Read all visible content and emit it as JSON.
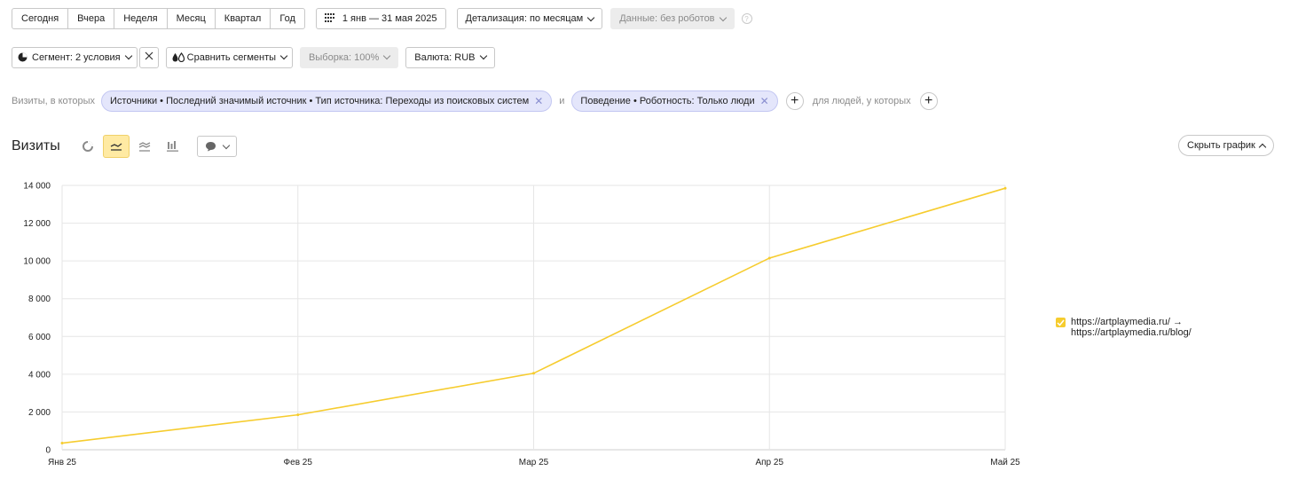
{
  "periods": [
    "Сегодня",
    "Вчера",
    "Неделя",
    "Месяц",
    "Квартал",
    "Год"
  ],
  "date_range": "1 янв — 31 мая 2025",
  "detail": "Детализация: по месяцам",
  "data_filter": "Данные: без роботов",
  "help": "?",
  "segment": "Сегмент: 2 условия",
  "compare": "Сравнить сегменты",
  "sample": "Выборка: 100%",
  "currency": "Валюта: RUB",
  "filters": {
    "visits_prefix": "Визиты, в которых",
    "chip1": "Источники • Последний значимый источник • Тип источника: Переходы из поисковых систем",
    "and": "и",
    "chip2": "Поведение • Роботность: Только люди",
    "people_label": "для людей, у которых"
  },
  "chart_header": {
    "title": "Визиты",
    "hide_chart": "Скрыть график"
  },
  "colors": {
    "line": "#f6cc2e",
    "grid": "#e6e6e6",
    "chip_bg": "#e4e6fb",
    "active_toggle": "#ffeaa3"
  },
  "icons": [
    "pie-chart-icon",
    "line-chart-icon",
    "area-chart-icon",
    "bar-chart-icon",
    "comment-icon",
    "calendar-icon",
    "close-icon"
  ],
  "chart_data": {
    "type": "line",
    "categories": [
      "Янв 25",
      "Фев 25",
      "Мар 25",
      "Апр 25",
      "Май 25"
    ],
    "series": [
      {
        "name": "https://artplaymedia.ru/ → https://artplaymedia.ru/blog/",
        "values": [
          350,
          1850,
          4050,
          10150,
          13850
        ]
      }
    ],
    "ylim": [
      0,
      14000
    ],
    "yticks": [
      0,
      2000,
      4000,
      6000,
      8000,
      10000,
      12000,
      14000
    ],
    "ytick_labels": [
      "0",
      "2 000",
      "4 000",
      "6 000",
      "8 000",
      "10 000",
      "12 000",
      "14 000"
    ],
    "grid": true,
    "legend": "right"
  },
  "legend_lines": [
    "https://artplaymedia.ru/ →",
    "https://artplaymedia.ru/blog/"
  ]
}
